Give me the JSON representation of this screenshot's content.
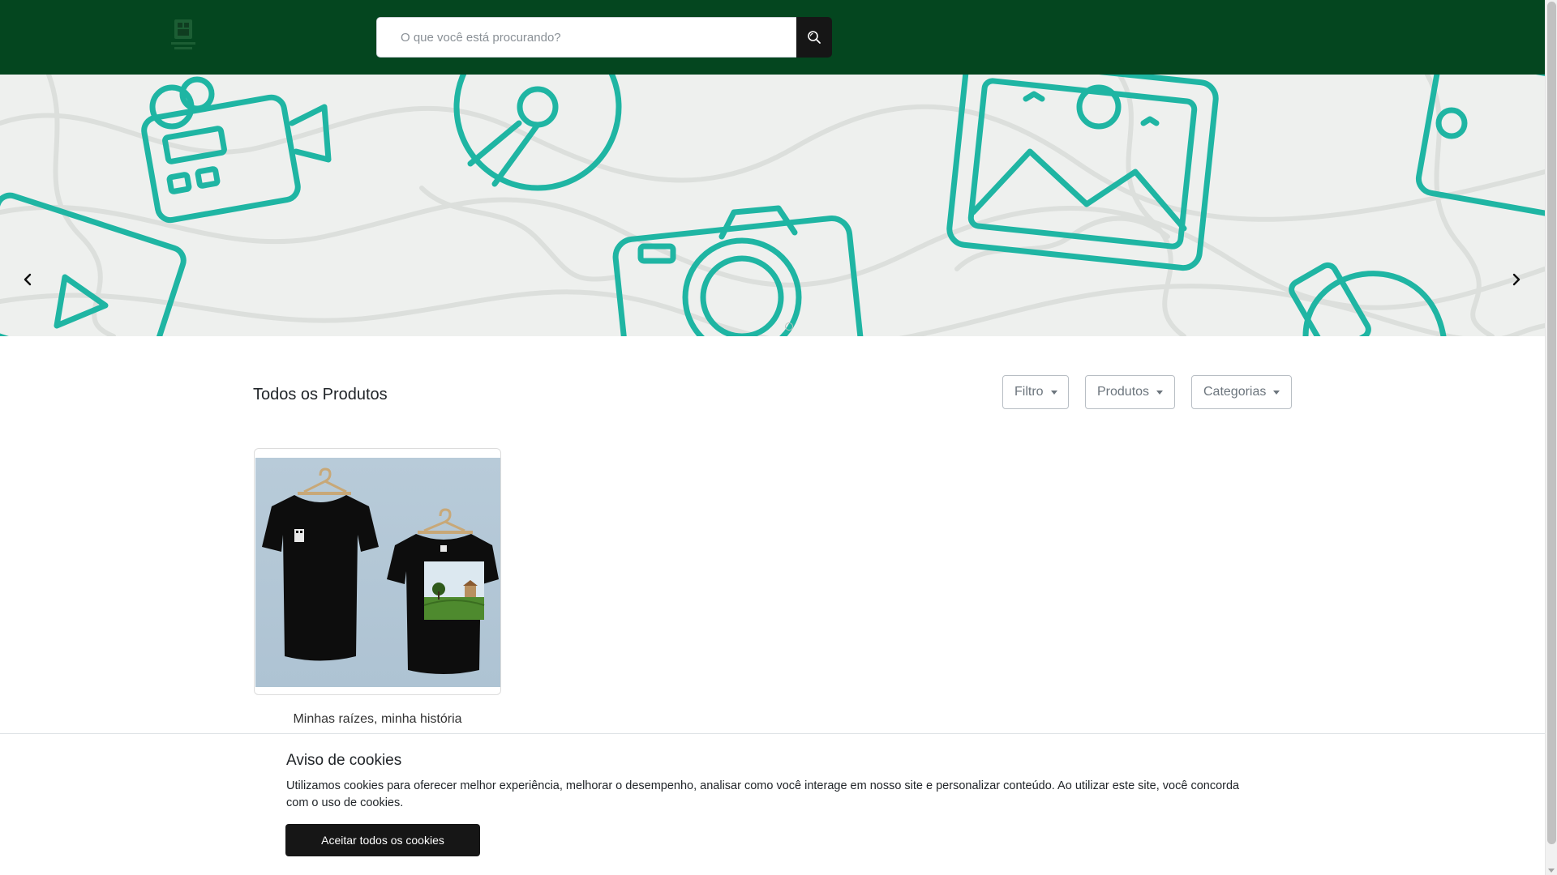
{
  "header": {
    "logo_icon": "store-logo-icon",
    "search": {
      "placeholder": "O que você está procurando?",
      "value": "",
      "button_icon": "search-icon"
    }
  },
  "banner": {
    "prev_icon": "chevron-left-icon",
    "next_icon": "chevron-right-icon",
    "slide_count": 1
  },
  "products": {
    "title": "Todos os Produtos",
    "filters": {
      "filtro": "Filtro",
      "produtos": "Produtos",
      "categorias": "Categorias"
    },
    "items": [
      {
        "name": "Minhas raízes, minha história"
      }
    ]
  },
  "cookie_notice": {
    "title": "Aviso de cookies",
    "text": "Utilizamos cookies para oferecer melhor experiência, melhorar o desempenho, analisar como você interage em nosso site e personalizar conteúdo. Ao utilizar este site, você concorda com o uso de cookies.",
    "accept_label": "Aceitar todos os cookies"
  },
  "colors": {
    "header_bg": "#04461f",
    "accent_teal": "#1fb5a3",
    "button_dark": "#161616"
  }
}
